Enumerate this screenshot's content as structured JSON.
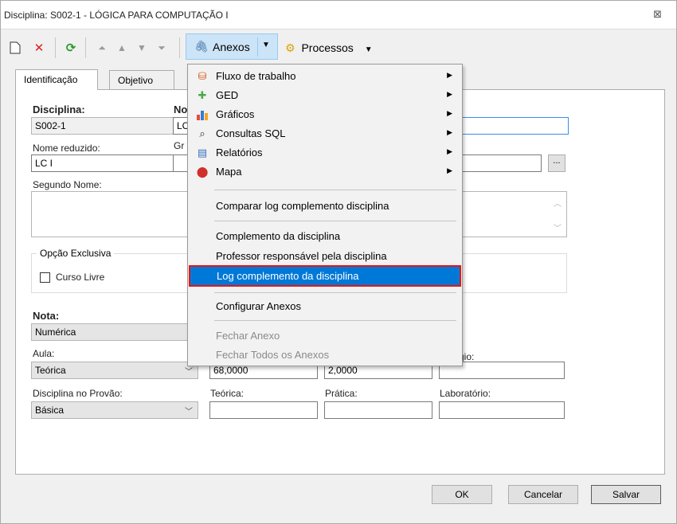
{
  "window": {
    "title": "Disciplina: S002-1 - LÓGICA PARA COMPUTAÇÃO I",
    "close_glyph": "⊠"
  },
  "toolbar": {
    "anexos_label": "Anexos",
    "processos_label": "Processos"
  },
  "tabs": [
    "Identificação",
    "Objetivo"
  ],
  "form": {
    "disciplina_label": "Disciplina:",
    "disciplina_value": "S002-1",
    "nome_label": "No",
    "nome_value": "LC",
    "nome_reduzido_label": "Nome reduzido:",
    "nome_reduzido_value": "LC I",
    "grupo_label": "Gr",
    "segundo_nome_label": "Segundo Nome:",
    "opcao_exclusiva_label": "Opção Exclusiva",
    "curso_livre_label": "Curso Livre",
    "curso_livre_checked": false,
    "nota_label": "Nota:",
    "nota_value": "Numérica",
    "aula_label": "Aula:",
    "aula_value": "Teórica",
    "carga_value": "68,0000",
    "creditos_value": "2,0000",
    "estagio_label": "gio:",
    "provao_label": "Disciplina no Provão:",
    "provao_value": "Básica",
    "teorica_label": "Teórica:",
    "pratica_label": "Prática:",
    "laboratorio_label": "Laboratório:",
    "ellipsis": "..."
  },
  "buttons": {
    "ok": "OK",
    "cancelar": "Cancelar",
    "salvar": "Salvar"
  },
  "menu": {
    "items_top": [
      {
        "label": "Fluxo de trabalho",
        "icon": "workflow-icon",
        "submenu": true
      },
      {
        "label": "GED",
        "icon": "ged-icon",
        "submenu": true
      },
      {
        "label": "Gráficos",
        "icon": "chart-icon",
        "submenu": true
      },
      {
        "label": "Consultas SQL",
        "icon": "sql-query-icon",
        "submenu": true
      },
      {
        "label": "Relatórios",
        "icon": "report-icon",
        "submenu": true
      },
      {
        "label": "Mapa",
        "icon": "map-pin-icon",
        "submenu": true
      }
    ],
    "comparar": "Comparar log complemento disciplina",
    "complemento": "Complemento da disciplina",
    "professor": "Professor responsável pela disciplina",
    "log": "Log complemento da disciplina",
    "configurar": "Configurar Anexos",
    "fechar": "Fechar Anexo",
    "fechar_todos": "Fechar Todos os Anexos"
  },
  "colors": {
    "highlight": "#0078d7",
    "highlight_border": "#e11111",
    "anexos_bg": "#cce4f7"
  }
}
